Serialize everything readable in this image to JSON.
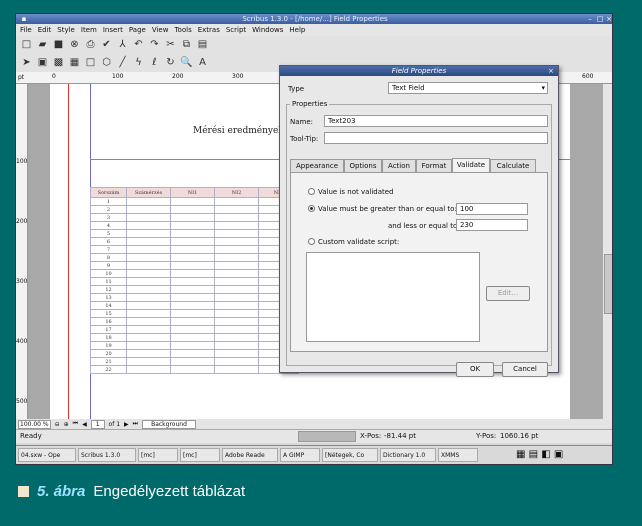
{
  "window": {
    "title": "Scribus 1.3.0 - [/home/...] Field Properties",
    "menu": [
      "File",
      "Edit",
      "Style",
      "Item",
      "Insert",
      "Page",
      "View",
      "Tools",
      "Extras",
      "Script",
      "Windows",
      "Help"
    ]
  },
  "ruler": {
    "unit": "pt",
    "marks": [
      "0",
      "100",
      "200",
      "300",
      "400",
      "500",
      "600"
    ],
    "vmarks": [
      "100",
      "200",
      "300",
      "400",
      "500"
    ]
  },
  "document": {
    "heading": "Mérési eredmények",
    "columns": [
      "Sorszám",
      "Számérzés",
      "NI1",
      "NI2",
      "NI3"
    ],
    "row_numbers": [
      "1",
      "2",
      "3",
      "4",
      "5",
      "6",
      "7",
      "8",
      "9",
      "10",
      "11",
      "12",
      "13",
      "14",
      "15",
      "16",
      "17",
      "18",
      "19",
      "20",
      "21",
      "22"
    ]
  },
  "bottom_bar": {
    "zoom": "100.00 %",
    "page": "1",
    "of": "of 1",
    "layer": "Background"
  },
  "status": {
    "text": "Ready",
    "xpos_label": "X-Pos:",
    "xpos": "-81.44 pt",
    "ypos_label": "Y-Pos:",
    "ypos": "1060.16 pt"
  },
  "taskbar": [
    "04.sxw - Ope",
    "Scribus 1.3.0",
    "[mc]",
    "[mc]",
    "Adobe Reade",
    "A GIMP",
    "[Nétegek, Co",
    "Dictionary 1.0",
    "XMMS"
  ],
  "dialog": {
    "title": "Field Properties",
    "type_label": "Type",
    "type_value": "Text Field",
    "group_label": "Properties",
    "name_label": "Name:",
    "name_value": "Text203",
    "tooltip_label": "Tool-Tip:",
    "tooltip_value": "",
    "tabs": [
      "Appearance",
      "Options",
      "Action",
      "Format",
      "Validate",
      "Calculate"
    ],
    "active_tab": "Validate",
    "opt_not_validated": "Value is not validated",
    "opt_greater": "Value must be greater than or equal to:",
    "greater_value": "100",
    "less_label": "and less or equal to:",
    "less_value": "230",
    "opt_custom": "Custom validate script:",
    "edit_label": "Edit...",
    "ok_label": "OK",
    "cancel_label": "Cancel"
  },
  "caption": {
    "number": "5. ábra",
    "text": "Engedélyezett táblázat"
  },
  "colors": {
    "frame": "#006a6a",
    "caption_number": "#9fe0ff",
    "table_header": "#f0dada"
  }
}
